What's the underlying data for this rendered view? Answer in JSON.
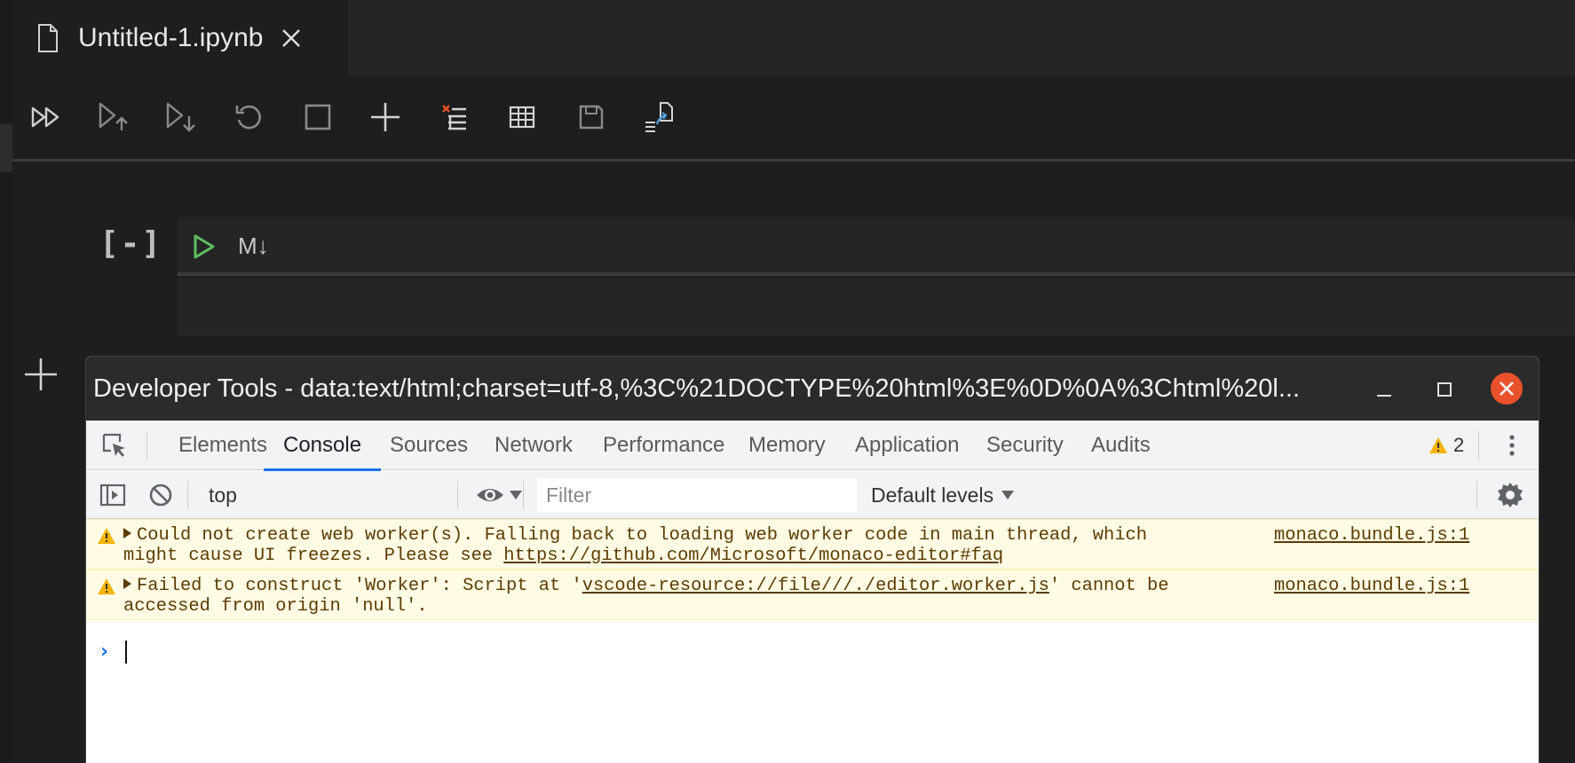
{
  "editor": {
    "tab_title": "Untitled-1.ipynb",
    "toolbar_buttons": [
      "run-all-icon",
      "run-above-icon",
      "run-below-icon",
      "restart-kernel-icon",
      "interrupt-icon",
      "add-cell-icon",
      "clear-outputs-icon",
      "variables-icon",
      "save-icon",
      "export-icon"
    ],
    "cell": {
      "execution_indicator": "[-]",
      "cell_type_toggle": "M↓"
    }
  },
  "devtools": {
    "window_title": "Developer Tools - data:text/html;charset=utf-8,%3C%21DOCTYPE%20html%3E%0D%0A%3Chtml%20l...",
    "tabs": [
      "Elements",
      "Console",
      "Sources",
      "Network",
      "Performance",
      "Memory",
      "Application",
      "Security",
      "Audits"
    ],
    "active_tab": "Console",
    "warning_count": "2",
    "console_bar": {
      "context": "top",
      "filter_placeholder": "Filter",
      "levels": "Default levels"
    },
    "messages": [
      {
        "level": "warning",
        "text_before_link": "Could not create web worker(s). Falling back to loading web worker code in main thread, which might cause UI freezes. Please see ",
        "link": "https://github.com/Microsoft/monaco-editor#faq",
        "text_after_link": "",
        "source": "monaco.bundle.js:1"
      },
      {
        "level": "warning",
        "text_before_link": "Failed to construct 'Worker': Script at '",
        "link": "vscode-resource://file///./editor.worker.js",
        "text_after_link": "' cannot be accessed from origin 'null'.",
        "source": "monaco.bundle.js:1"
      }
    ],
    "colors": {
      "accent": "#1a73e8",
      "warning_bg": "#fffbe5",
      "warning_text": "#5c3c00",
      "close_button": "#e8512a"
    }
  }
}
